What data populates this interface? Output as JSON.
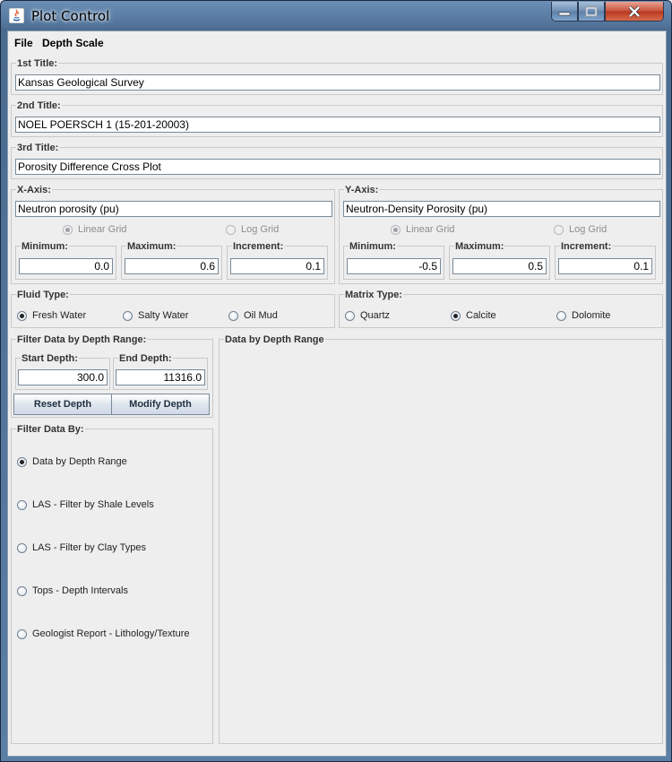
{
  "window": {
    "title": "Plot Control"
  },
  "menu": {
    "file": "File",
    "depth_scale": "Depth Scale"
  },
  "titles": {
    "first": {
      "label": "1st Title:",
      "value": "Kansas Geological Survey"
    },
    "second": {
      "label": "2nd Title:",
      "value": "NOEL POERSCH 1 (15-201-20003)"
    },
    "third": {
      "label": "3rd Title:",
      "value": "Porosity Difference Cross Plot"
    }
  },
  "x_axis": {
    "label": "X-Axis:",
    "name": "Neutron porosity (pu)",
    "grid": {
      "linear": "Linear Grid",
      "log": "Log Grid",
      "selected": "linear"
    },
    "min_label": "Minimum:",
    "min": "0.0",
    "max_label": "Maximum:",
    "max": "0.6",
    "inc_label": "Increment:",
    "inc": "0.1"
  },
  "y_axis": {
    "label": "Y-Axis:",
    "name": "Neutron-Density Porosity (pu)",
    "grid": {
      "linear": "Linear Grid",
      "log": "Log Grid",
      "selected": "linear"
    },
    "min_label": "Minimum:",
    "min": "-0.5",
    "max_label": "Maximum:",
    "max": "0.5",
    "inc_label": "Increment:",
    "inc": "0.1"
  },
  "fluid": {
    "label": "Fluid Type:",
    "options": [
      "Fresh Water",
      "Salty Water",
      "Oil Mud"
    ],
    "selected": "Fresh Water"
  },
  "matrix": {
    "label": "Matrix Type:",
    "options": [
      "Quartz",
      "Calcite",
      "Dolomite"
    ],
    "selected": "Calcite"
  },
  "depth_filter": {
    "label": "Filter Data by Depth Range:",
    "start_label": "Start Depth:",
    "start": "300.0",
    "end_label": "End Depth:",
    "end": "11316.0",
    "reset": "Reset Depth",
    "modify": "Modify Depth"
  },
  "filter_by": {
    "label": "Filter Data By:",
    "options": [
      "Data by Depth Range",
      "LAS - Filter by Shale Levels",
      "LAS - Filter by Clay Types",
      "Tops - Depth Intervals",
      "Geologist Report - Lithology/Texture"
    ],
    "selected": "Data by Depth Range"
  },
  "right_panel": {
    "label": "Data by Depth Range"
  },
  "icons": {
    "app": "java-icon",
    "minimize": "minimize-icon",
    "maximize": "maximize-icon",
    "close": "close-icon"
  }
}
